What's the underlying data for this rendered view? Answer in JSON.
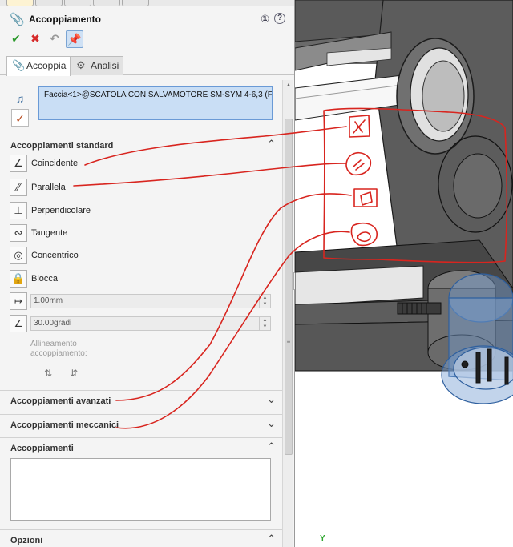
{
  "panel": {
    "title": "Accoppiamento",
    "help_symbol": "?",
    "tabs": [
      {
        "label": "Accoppia",
        "icon": "paperclip-icon"
      },
      {
        "label": "Analisi",
        "icon": "gears-icon"
      }
    ],
    "selection": {
      "text": "Faccia<1>@SCATOLA CON SALVAMOTORE SM-SYM 4-6,3 (Frizi"
    }
  },
  "sections": {
    "standard": "Accoppiamenti standard",
    "advanced": "Accoppiamenti avanzati",
    "mechanical": "Accoppiamenti meccanici",
    "mates": "Accoppiamenti",
    "options": "Opzioni"
  },
  "standard_mates": [
    {
      "label": "Coincidente",
      "icon": "coincident-icon"
    },
    {
      "label": "Parallela",
      "icon": "parallel-icon"
    },
    {
      "label": "Perpendicolare",
      "icon": "perpendicular-icon"
    },
    {
      "label": "Tangente",
      "icon": "tangent-icon"
    },
    {
      "label": "Concentrico",
      "icon": "concentric-icon"
    },
    {
      "label": "Blocca",
      "icon": "lock-icon"
    }
  ],
  "distance": {
    "value": "1.00mm"
  },
  "angle": {
    "value": "30.00gradi"
  },
  "alignment": {
    "label": "Allineamento accoppiamento:"
  },
  "graphics": {
    "triad_label": "Y",
    "annotation_color": "#d8251f"
  }
}
